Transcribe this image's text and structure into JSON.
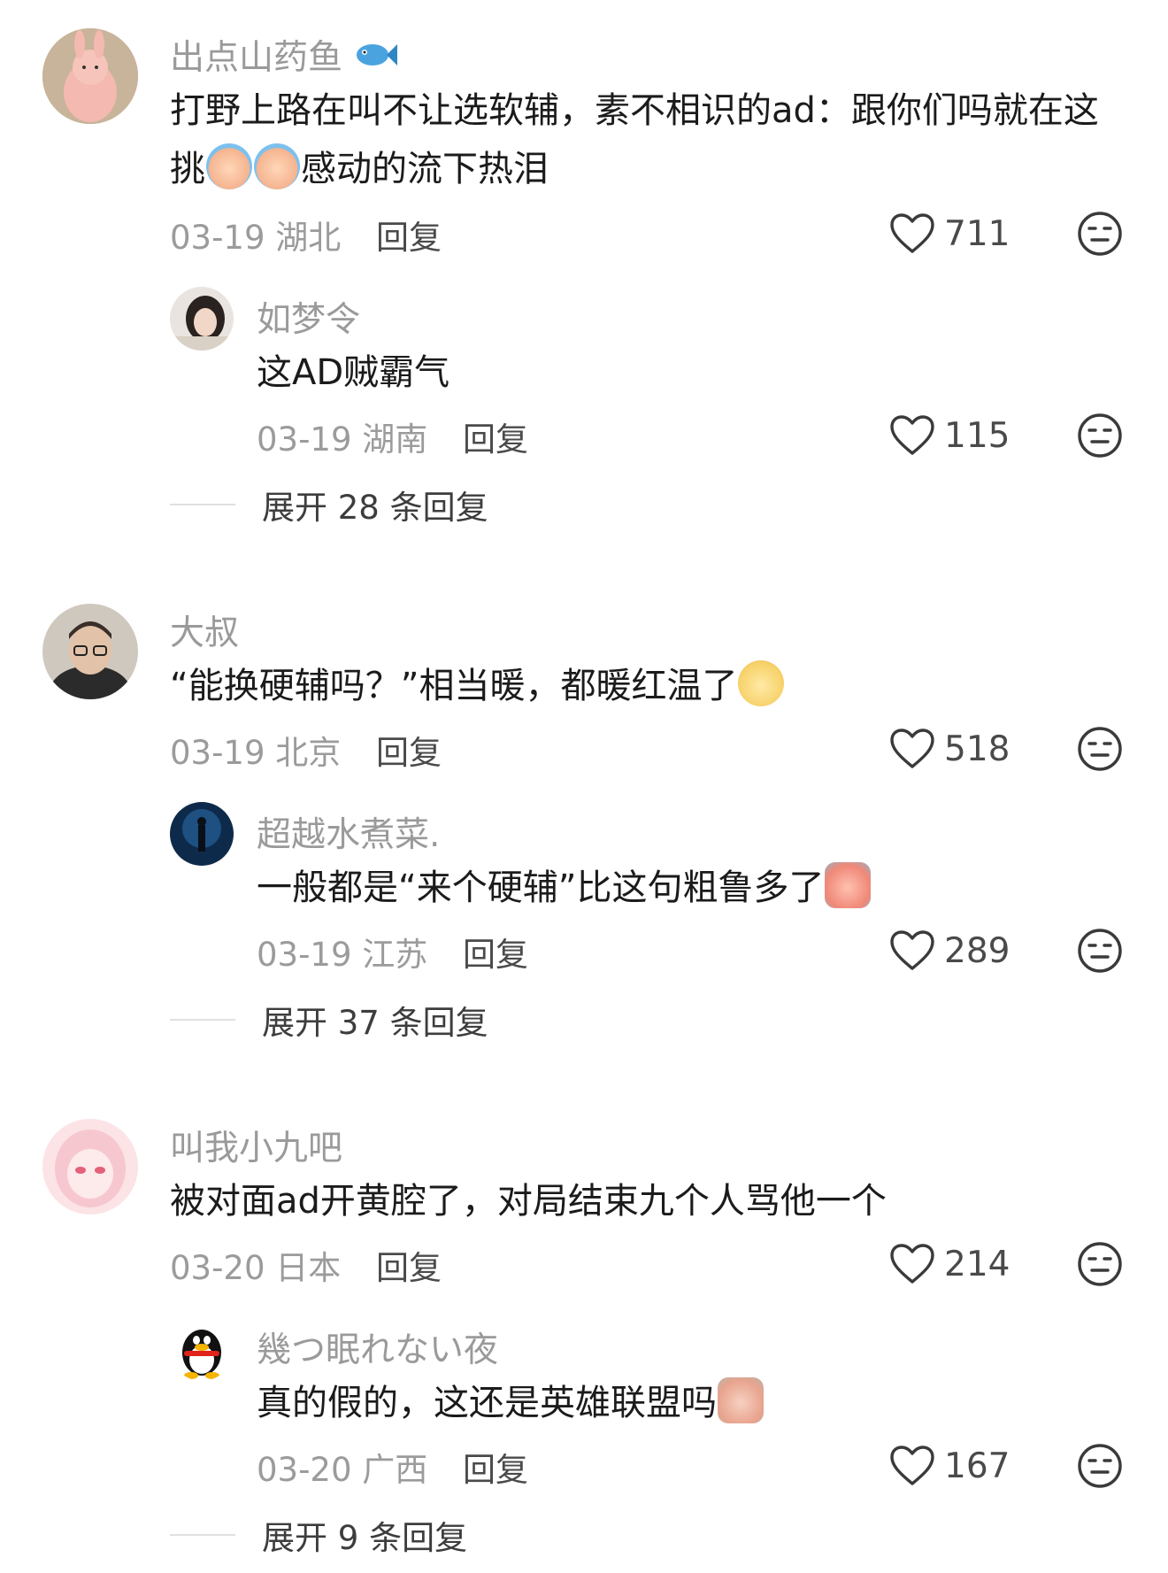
{
  "comments": [
    {
      "username": "出点山药鱼",
      "username_emoji": "fish-icon",
      "text_a": "打野上路在叫不让选软辅，素不相识的ad：跟你们吗就在这挑",
      "text_b": "感动的流下热泪",
      "date": "03-19",
      "location": "湖北",
      "reply_label": "回复",
      "likes": "711",
      "replies": [
        {
          "username": "如梦令",
          "text": "这AD贼霸气",
          "date": "03-19",
          "location": "湖南",
          "reply_label": "回复",
          "likes": "115"
        }
      ],
      "expand_label": "展开 28 条回复"
    },
    {
      "username": "大叔",
      "text": "“能换硬辅吗？”相当暖，都暖红温了",
      "date": "03-19",
      "location": "北京",
      "reply_label": "回复",
      "likes": "518",
      "replies": [
        {
          "username": "超越水煮菜.",
          "text": "一般都是“来个硬辅”比这句粗鲁多了",
          "date": "03-19",
          "location": "江苏",
          "reply_label": "回复",
          "likes": "289"
        }
      ],
      "expand_label": "展开 37 条回复"
    },
    {
      "username": "叫我小九吧",
      "text": "被对面ad开黄腔了，对局结束九个人骂他一个",
      "date": "03-20",
      "location": "日本",
      "reply_label": "回复",
      "likes": "214",
      "replies": [
        {
          "username": "幾つ眠れない夜",
          "text": "真的假的，这还是英雄联盟吗",
          "date": "03-20",
          "location": "广西",
          "reply_label": "回复",
          "likes": "167"
        }
      ],
      "expand_label": "展开 9 条回复"
    }
  ],
  "colors": {
    "username": "#9a9a9a",
    "text": "#1b1b1b",
    "meta": "#9b9b9b",
    "reply": "#4a4a4a"
  }
}
